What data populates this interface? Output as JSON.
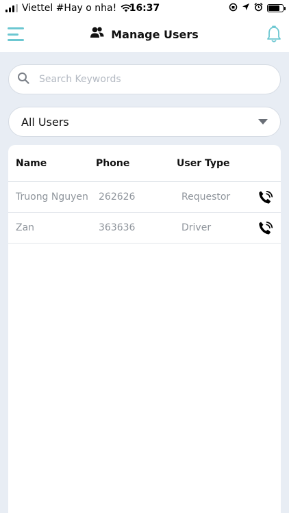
{
  "status_bar": {
    "carrier": "Viettel #Hay o nha!",
    "time": "16:37"
  },
  "header": {
    "title": "Manage Users",
    "menu_icon": "hamburger-menu-icon",
    "title_icon": "users-icon",
    "bell_icon": "bell-icon",
    "accent_color": "#6cc7d1"
  },
  "search": {
    "value": "",
    "placeholder": "Search Keywords"
  },
  "filter": {
    "selected": "All Users"
  },
  "table": {
    "columns": [
      "Name",
      "Phone",
      "User Type"
    ],
    "rows": [
      {
        "name": "Truong Nguyen",
        "phone": "262626",
        "type": "Requestor"
      },
      {
        "name": "Zan",
        "phone": "363636",
        "type": "Driver"
      }
    ]
  }
}
